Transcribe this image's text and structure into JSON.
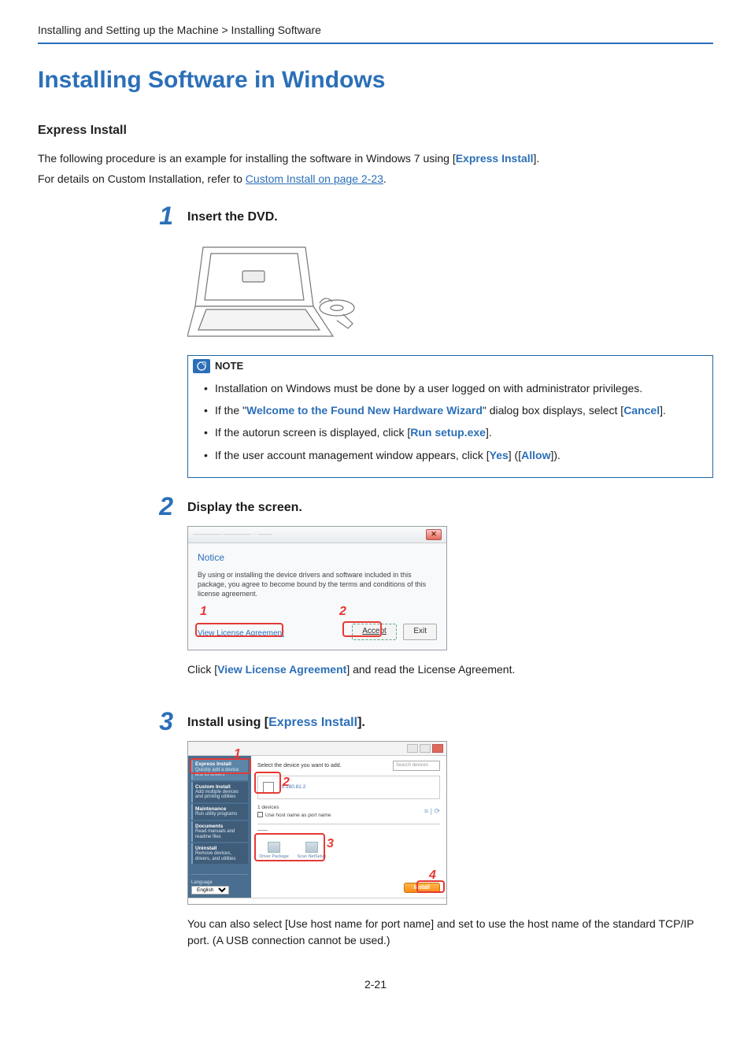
{
  "breadcrumb": "Installing and Setting up the Machine > Installing Software",
  "heading": "Installing Software in Windows",
  "subHeading": "Express Install",
  "intro1_pre": "The following procedure is an example for installing the software in Windows 7 using [",
  "intro1_bold": "Express Install",
  "intro1_post": "].",
  "intro2_pre": "For details on Custom Installation, refer to ",
  "intro2_link": "Custom Install on page 2-23",
  "intro2_post": ".",
  "steps": {
    "s1": {
      "num": "1",
      "title": "Insert the DVD."
    },
    "s2": {
      "num": "2",
      "title": "Display the screen.",
      "caption_pre": "Click [",
      "caption_bold": "View License Agreement",
      "caption_post": "] and read the License Agreement."
    },
    "s3": {
      "num": "3",
      "title_pre": "Install using [",
      "title_bold": "Express Install",
      "title_post": "].",
      "caption": "You can also select [Use host name for port name] and set to use the host name of the standard TCP/IP port. (A USB connection cannot be used.)"
    }
  },
  "note": {
    "label": "NOTE",
    "items": {
      "a": "Installation on Windows must be done by a user logged on with administrator privileges.",
      "b_pre": "If the \"",
      "b_bold1": "Welcome to the Found New Hardware Wizard",
      "b_mid": "\" dialog box displays, select [",
      "b_bold2": "Cancel",
      "b_post": "].",
      "c_pre": "If the autorun screen is displayed, click [",
      "c_bold": "Run setup.exe",
      "c_post": "].",
      "d_pre": "If the user account management window appears, click [",
      "d_bold1": "Yes",
      "d_mid": "] ([",
      "d_bold2": "Allow",
      "d_post": "])."
    }
  },
  "dlg2": {
    "close": "✕",
    "notice": "Notice",
    "text": "By using or installing the device drivers and software included in this package, you agree to become bound by the terms and conditions of this license agreement.",
    "view": "View License Agreement",
    "accept": "Accept",
    "exit": "Exit",
    "callout1": "1",
    "callout2": "2"
  },
  "dlg3": {
    "side": {
      "express_title": "Express Install",
      "express_sub": "Quickly add a device and its drivers",
      "custom_title": "Custom Install",
      "custom_sub": "Add multiple devices and printing utilities",
      "maint_title": "Maintenance",
      "maint_sub": "Run utility programs",
      "doc_title": "Documents",
      "doc_sub": "Read manuals and readme files",
      "uninst_title": "Uninstall",
      "uninst_sub": "Remove devices, drivers, and utilities",
      "lang_label": "Language",
      "lang_value": "English"
    },
    "main": {
      "select_label": "Select the device you want to add.",
      "search_placeholder": "Search devices",
      "dev_text": "10.180.81.2",
      "devcount": "1 devices",
      "host_label": "Use host name as port name",
      "feat1": "Driver Package",
      "feat2": "Scan NetSetup",
      "install": "Install"
    },
    "callouts": {
      "c1": "1",
      "c2": "2",
      "c3": "3",
      "c4": "4"
    }
  },
  "pageNumber": "2-21"
}
